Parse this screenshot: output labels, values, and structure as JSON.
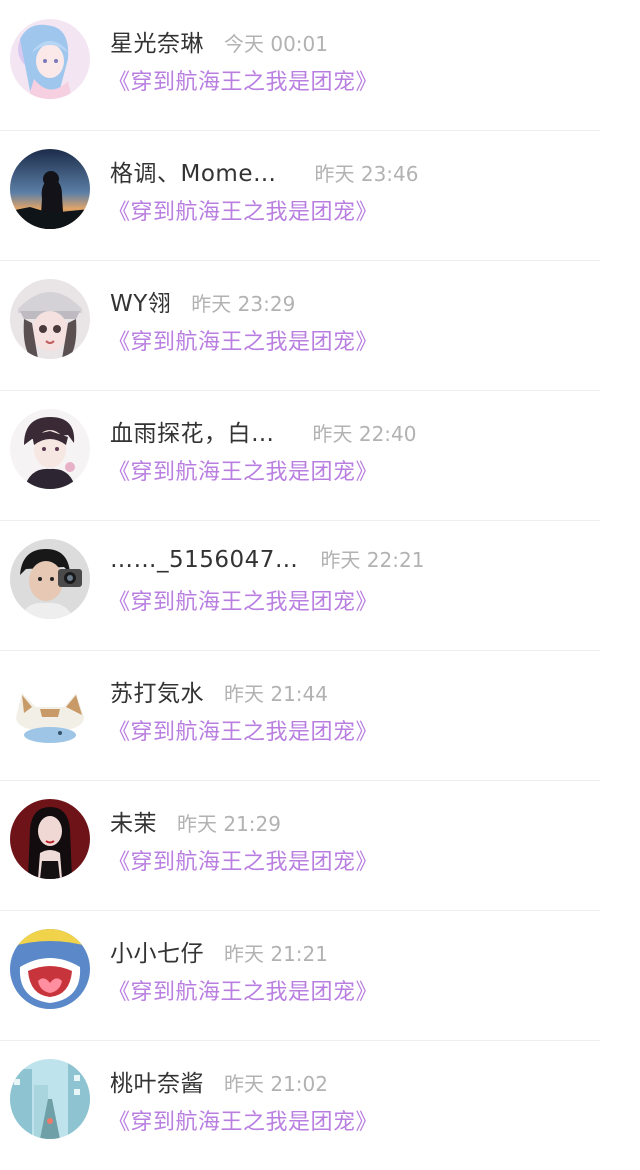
{
  "messages": [
    {
      "name": "星光奈琳",
      "time": "今天 00:01",
      "subtitle": "《穿到航海王之我是团宠》",
      "avatar_icon": "anime-girl-pastel-avatar"
    },
    {
      "name": "格调、Mome…",
      "time": "昨天 23:46",
      "subtitle": "《穿到航海王之我是团宠》",
      "avatar_icon": "silhouette-sunset-avatar"
    },
    {
      "name": "WY翎",
      "time": "昨天 23:29",
      "subtitle": "《穿到航海王之我是团宠》",
      "avatar_icon": "anime-girl-cap-avatar"
    },
    {
      "name": "血雨探花，白…",
      "time": "昨天 22:40",
      "subtitle": "《穿到航海王之我是团宠》",
      "avatar_icon": "anime-boy-avatar"
    },
    {
      "name": "……_5156047…",
      "time": "昨天 22:21",
      "subtitle": "《穿到航海王之我是团宠》",
      "avatar_icon": "boy-camera-avatar"
    },
    {
      "name": "苏打気水",
      "time": "昨天 21:44",
      "subtitle": "《穿到航海王之我是团宠》",
      "avatar_icon": "cat-fish-avatar"
    },
    {
      "name": "未茉",
      "time": "昨天 21:29",
      "subtitle": "《穿到航海王之我是团宠》",
      "avatar_icon": "dark-girl-avatar"
    },
    {
      "name": "小小七仔",
      "time": "昨天 21:21",
      "subtitle": "《穿到航海王之我是团宠》",
      "avatar_icon": "cartoon-mouth-avatar"
    },
    {
      "name": "桃叶奈酱",
      "time": "昨天 21:02",
      "subtitle": "《穿到航海王之我是团宠》",
      "avatar_icon": "city-street-avatar"
    }
  ],
  "colors": {
    "name": "#333333",
    "time": "#b2b2b2",
    "subtitle": "#b97fe0",
    "divider": "#eeeeee"
  }
}
